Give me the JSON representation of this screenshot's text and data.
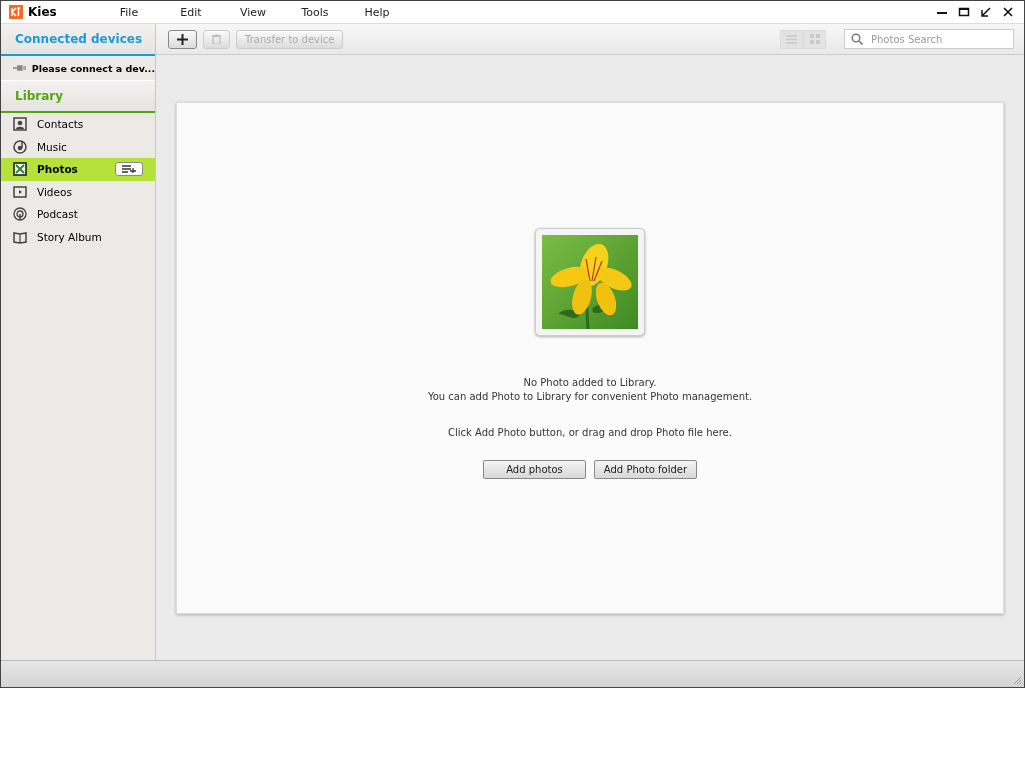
{
  "window": {
    "title": "Kies"
  },
  "menu": [
    "File",
    "Edit",
    "View",
    "Tools",
    "Help"
  ],
  "sidebar": {
    "connected_header": "Connected devices",
    "device_prompt": "Please connect a dev...",
    "library_header": "Library",
    "items": [
      {
        "label": "Contacts",
        "selected": false
      },
      {
        "label": "Music",
        "selected": false
      },
      {
        "label": "Photos",
        "selected": true
      },
      {
        "label": "Videos",
        "selected": false
      },
      {
        "label": "Podcast",
        "selected": false
      },
      {
        "label": "Story Album",
        "selected": false
      }
    ]
  },
  "toolbar": {
    "transfer_button": {
      "label": "Transfer to device",
      "disabled": true
    },
    "delete_disabled": true,
    "search": {
      "placeholder": "Photos Search"
    }
  },
  "content": {
    "message_lines": [
      "No Photo added to Library.",
      "You can add Photo to Library for convenient Photo management."
    ],
    "hint": "Click Add Photo button, or drag and drop Photo file here.",
    "buttons": [
      "Add photos",
      "Add Photo folder"
    ]
  }
}
